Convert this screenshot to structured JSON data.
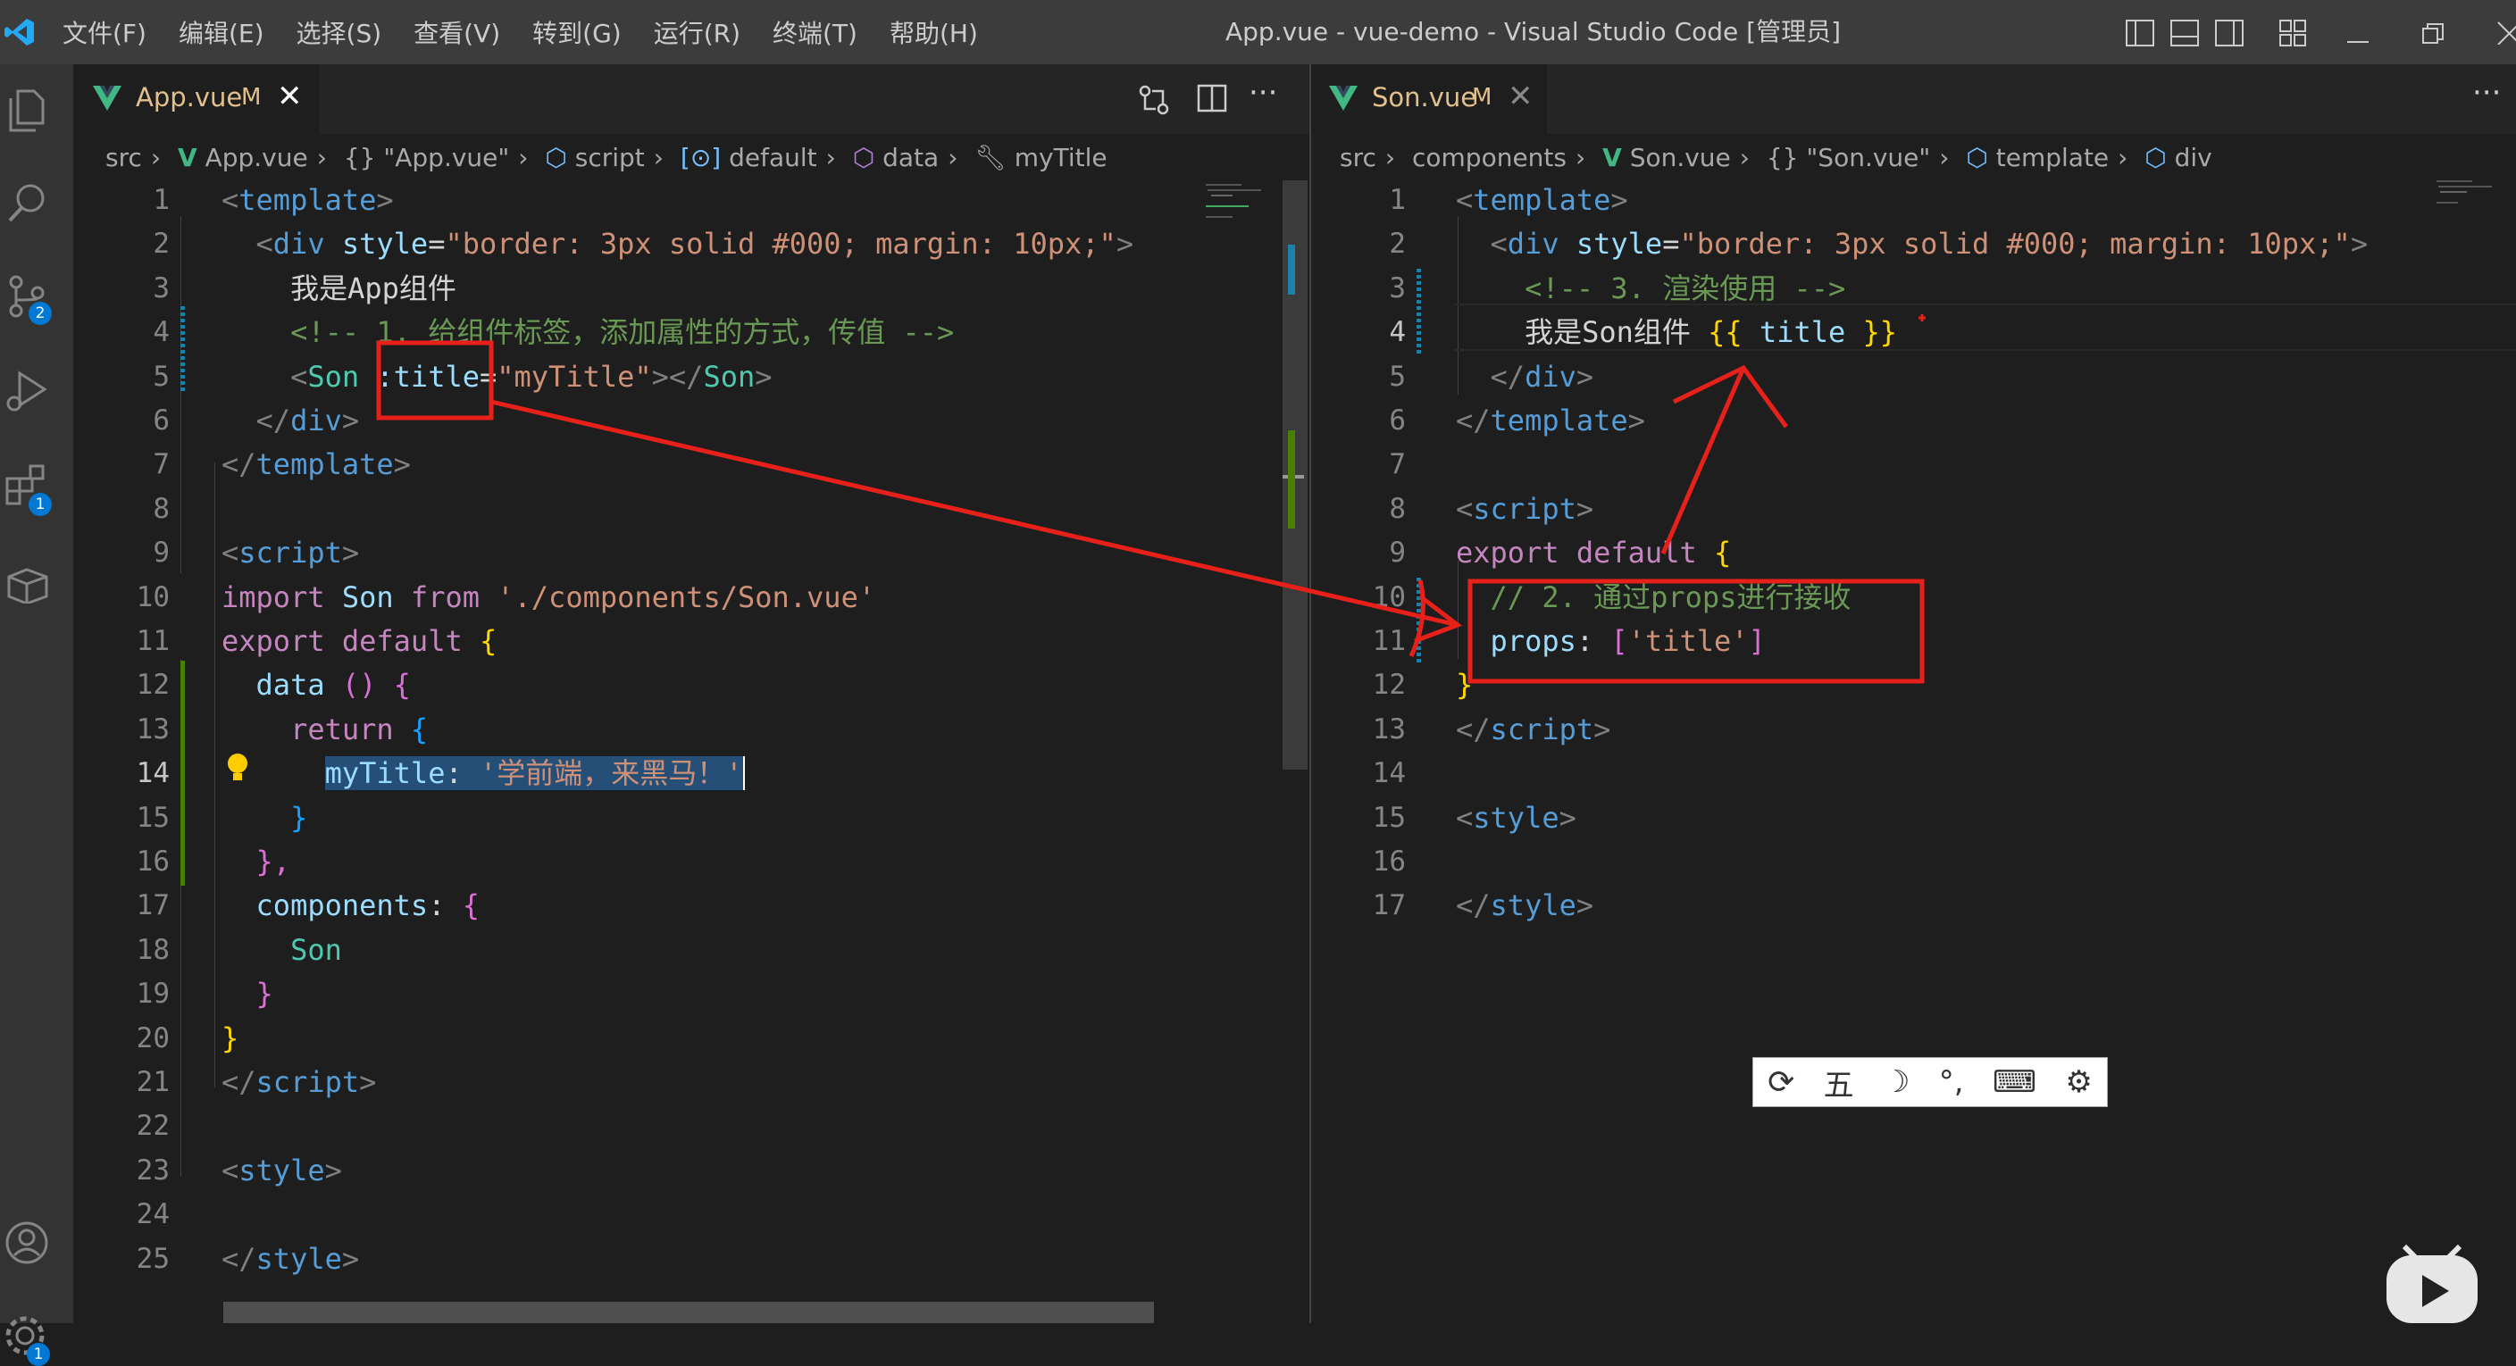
{
  "window": {
    "title": "App.vue - vue-demo - Visual Studio Code [管理员]",
    "menu": [
      "文件(F)",
      "编辑(E)",
      "选择(S)",
      "查看(V)",
      "转到(G)",
      "运行(R)",
      "终端(T)",
      "帮助(H)"
    ]
  },
  "activity_bar": {
    "badges": {
      "source_control": "2",
      "extensions": "1",
      "settings": "1"
    }
  },
  "left_editor": {
    "tab": {
      "name": "App.vue",
      "status": "M"
    },
    "breadcrumb": [
      "src",
      "App.vue",
      "{} \"App.vue\"",
      "script",
      "default",
      "data",
      "myTitle"
    ],
    "line_numbers": [
      "1",
      "2",
      "3",
      "4",
      "5",
      "6",
      "7",
      "8",
      "9",
      "10",
      "11",
      "12",
      "13",
      "14",
      "15",
      "16",
      "17",
      "18",
      "19",
      "20",
      "21",
      "22",
      "23",
      "24",
      "25"
    ],
    "active_line": "14",
    "code": {
      "l1_tag": "template",
      "l2_tag": "div",
      "l2_attr": "style",
      "l2_val": "\"border: 3px solid #000; margin: 10px;\"",
      "l3_text": "我是App组件",
      "l4_comment": "<!-- 1. 给组件标签，添加属性的方式，传值 -->",
      "l5_tag": "Son",
      "l5_attr": ":title",
      "l5_val": "\"myTitle\"",
      "l5_close": "Son",
      "l6_tag": "div",
      "l7_tag": "template",
      "l9_tag": "script",
      "l10_kw": "import",
      "l10_name": "Son",
      "l10_from": "from",
      "l10_path": "'./components/Son.vue'",
      "l11_kw": "export",
      "l11_kw2": "default",
      "l12_name": "data",
      "l13_kw": "return",
      "l14_key": "myTitle",
      "l14_val": "'学前端，来黑马！'",
      "l17_name": "components",
      "l18_name": "Son",
      "l21_tag": "script",
      "l23_tag": "style",
      "l25_tag": "style"
    }
  },
  "right_editor": {
    "tab": {
      "name": "Son.vue",
      "status": "M"
    },
    "breadcrumb": [
      "src",
      "components",
      "Son.vue",
      "{} \"Son.vue\"",
      "template",
      "div"
    ],
    "line_numbers": [
      "1",
      "2",
      "3",
      "4",
      "5",
      "6",
      "7",
      "8",
      "9",
      "10",
      "11",
      "12",
      "13",
      "14",
      "15",
      "16",
      "17"
    ],
    "active_line": "4",
    "code": {
      "l1_tag": "template",
      "l2_tag": "div",
      "l2_attr": "style",
      "l2_val": "\"border: 3px solid #000; margin: 10px;\"",
      "l3_comment": "<!-- 3. 渲染使用 -->",
      "l4_text": "我是Son组件",
      "l4_expr": "title",
      "l5_tag": "div",
      "l6_tag": "template",
      "l8_tag": "script",
      "l9_kw": "export",
      "l9_kw2": "default",
      "l10_comment": "// 2. 通过props进行接收",
      "l11_key": "props",
      "l11_val": "'title'",
      "l13_tag": "script",
      "l15_tag": "style",
      "l17_tag": "style"
    }
  },
  "ime_toolbar": {
    "items": [
      "五",
      "☽",
      "°,",
      "⌨",
      "⚙"
    ]
  },
  "colors": {
    "annotation": "#e8201a",
    "accent": "#0078d4",
    "vue_green": "#41b883"
  }
}
